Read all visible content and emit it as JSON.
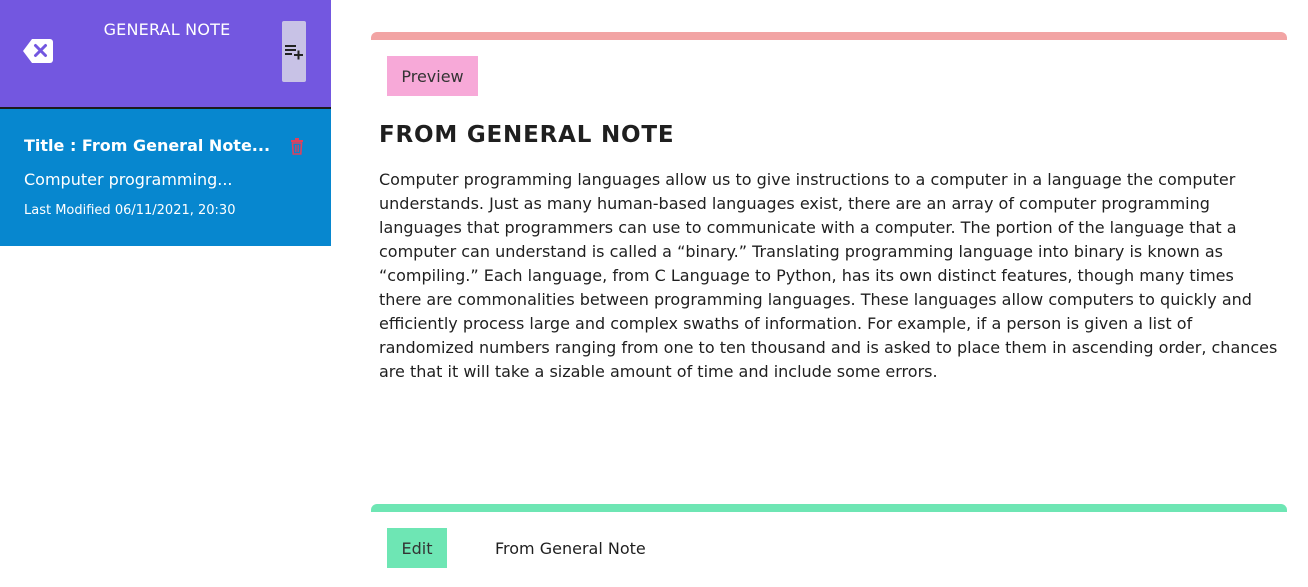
{
  "sidebar": {
    "title": "GENERAL NOTE",
    "close_icon": "backspace-x-icon",
    "add_icon": "playlist-add-icon",
    "header_color": "#7357e0",
    "notes": [
      {
        "title": "Title : From General Note...",
        "preview": "Computer programming...",
        "modified": "Last Modified 06/11/2021, 20:30",
        "delete_icon": "trash-icon",
        "color": "#0787cf"
      }
    ]
  },
  "preview": {
    "button_label": "Preview",
    "heading": "FROM GENERAL NOTE",
    "body": "Computer programming languages allow us to give instructions to a computer in a language the computer understands. Just as many human-based languages exist, there are an array of computer programming languages that programmers can use to communicate with a computer. The portion of the language that a computer can understand is called a “binary.” Translating programming language into binary is known as “compiling.” Each language, from C Language to Python, has its own distinct features, though many times there are commonalities between programming languages. These languages allow computers to quickly and efficiently process large and complex swaths of information. For example, if a person is given a list of randomized numbers ranging from one to ten thousand and is asked to place them in ascending order, chances are that it will take a sizable amount of time and include some errors.",
    "accent_color": "#f2a4a4",
    "button_color": "#f7a9d8"
  },
  "editor": {
    "button_label": "Edit",
    "title_value": "From General Note",
    "accent_color": "#6ee6b4"
  }
}
